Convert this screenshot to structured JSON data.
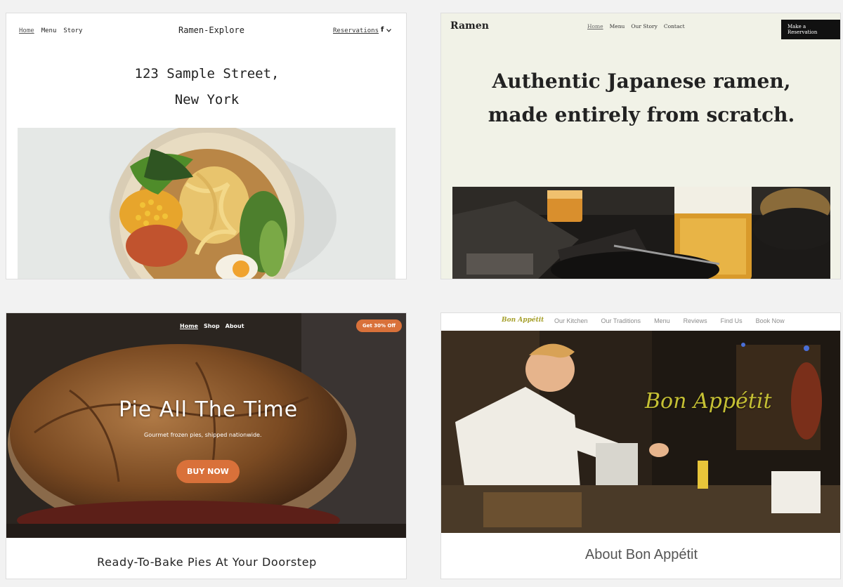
{
  "ramen_explore": {
    "nav": [
      "Home",
      "Menu",
      "Story"
    ],
    "brand": "Ramen-Explore",
    "address_line1": "123 Sample Street,",
    "address_line2": "New York",
    "reservations_label": "Reservations",
    "social_label": "f",
    "social_icon": "chevron-down-icon"
  },
  "ramen": {
    "brand": "Ramen",
    "nav": [
      "Home",
      "Menu",
      "Our Story",
      "Contact"
    ],
    "cta_label": "Make a Reservation",
    "headline_line1": "Authentic Japanese ramen,",
    "headline_line2": "made entirely from scratch."
  },
  "pie": {
    "nav": [
      "Home",
      "Shop",
      "About"
    ],
    "promo_label": "Get 30% Off",
    "title": "Pie All The Time",
    "subtitle": "Gourmet frozen pies, shipped nationwide.",
    "buy_label": "BUY NOW",
    "footer_heading": "Ready-To-Bake Pies At Your Doorstep",
    "accent": "#d9713a"
  },
  "bon_appetit": {
    "brand": "Bon Appétit",
    "nav": [
      "Our Kitchen",
      "Our Traditions",
      "Menu",
      "Reviews",
      "Find Us",
      "Book Now"
    ],
    "hero_title": "Bon Appétit",
    "about_heading": "About Bon Appétit",
    "accent": "#c5c034"
  }
}
